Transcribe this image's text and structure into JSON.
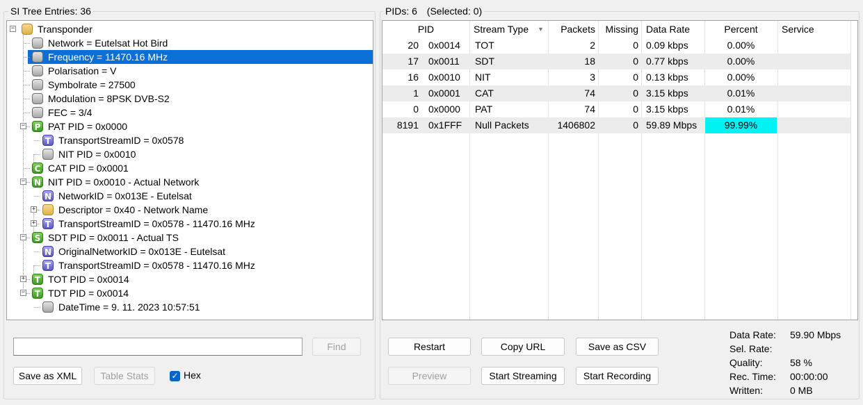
{
  "si_tree": {
    "title": "SI Tree Entries: 36",
    "nodes": [
      {
        "label": "Transponder",
        "icon": "folder-icon",
        "badge": ""
      },
      {
        "label": "Network = Eutelsat Hot Bird",
        "icon": "gray-node-icon",
        "badge": ""
      },
      {
        "label": "Frequency = 11470.16 MHz",
        "icon": "gray-node-icon",
        "badge": ""
      },
      {
        "label": "Polarisation = V",
        "icon": "gray-node-icon",
        "badge": ""
      },
      {
        "label": "Symbolrate = 27500",
        "icon": "gray-node-icon",
        "badge": ""
      },
      {
        "label": "Modulation = 8PSK DVB-S2",
        "icon": "gray-node-icon",
        "badge": ""
      },
      {
        "label": "FEC = 3/4",
        "icon": "gray-node-icon",
        "badge": ""
      },
      {
        "label": "PAT PID = 0x0000",
        "icon": "pat-icon",
        "badge": "P"
      },
      {
        "label": "TransportStreamID = 0x0578",
        "icon": "transport-stream-icon",
        "badge": "T"
      },
      {
        "label": "NIT PID = 0x0010",
        "icon": "gray-node-icon",
        "badge": ""
      },
      {
        "label": "CAT PID = 0x0001",
        "icon": "cat-icon",
        "badge": "C"
      },
      {
        "label": "NIT PID = 0x0010 - Actual Network",
        "icon": "nit-icon",
        "badge": "N"
      },
      {
        "label": "NetworkID = 0x013E - Eutelsat",
        "icon": "network-id-icon",
        "badge": "N"
      },
      {
        "label": "Descriptor = 0x40 - Network Name",
        "icon": "folder-icon",
        "badge": ""
      },
      {
        "label": "TransportStreamID = 0x0578 - 11470.16 MHz",
        "icon": "transport-stream-icon",
        "badge": "T"
      },
      {
        "label": "SDT PID = 0x0011 - Actual TS",
        "icon": "sdt-icon",
        "badge": "S"
      },
      {
        "label": "OriginalNetworkID = 0x013E - Eutelsat",
        "icon": "network-id-icon",
        "badge": "N"
      },
      {
        "label": "TransportStreamID = 0x0578 - 11470.16 MHz",
        "icon": "transport-stream-icon",
        "badge": "T"
      },
      {
        "label": "TOT PID = 0x0014",
        "icon": "tot-icon",
        "badge": "T"
      },
      {
        "label": "TDT PID = 0x0014",
        "icon": "tdt-icon",
        "badge": "T"
      },
      {
        "label": "DateTime = 9. 11. 2023 10:57:51",
        "icon": "gray-node-icon",
        "badge": ""
      }
    ],
    "search_value": "",
    "find_label": "Find",
    "save_xml_label": "Save as XML",
    "table_stats_label": "Table Stats",
    "hex_label": "Hex",
    "hex_checked": true
  },
  "pids": {
    "title": "PIDs: 6",
    "selected": "(Selected: 0)",
    "columns": [
      "PID",
      "Stream Type",
      "Packets",
      "Missing",
      "Data Rate",
      "Percent",
      "Service"
    ],
    "rows": [
      {
        "pid_dec": "20",
        "pid_hex": "0x0014",
        "stream_type": "TOT",
        "packets": "2",
        "missing": "0",
        "data_rate": "0.09 kbps",
        "percent": "0.00%",
        "percent_value": 0.0,
        "service": ""
      },
      {
        "pid_dec": "17",
        "pid_hex": "0x0011",
        "stream_type": "SDT",
        "packets": "18",
        "missing": "0",
        "data_rate": "0.77 kbps",
        "percent": "0.00%",
        "percent_value": 0.0,
        "service": ""
      },
      {
        "pid_dec": "16",
        "pid_hex": "0x0010",
        "stream_type": "NIT",
        "packets": "3",
        "missing": "0",
        "data_rate": "0.13 kbps",
        "percent": "0.00%",
        "percent_value": 0.0,
        "service": ""
      },
      {
        "pid_dec": "1",
        "pid_hex": "0x0001",
        "stream_type": "CAT",
        "packets": "74",
        "missing": "0",
        "data_rate": "3.15 kbps",
        "percent": "0.01%",
        "percent_value": 0.01,
        "service": ""
      },
      {
        "pid_dec": "0",
        "pid_hex": "0x0000",
        "stream_type": "PAT",
        "packets": "74",
        "missing": "0",
        "data_rate": "3.15 kbps",
        "percent": "0.01%",
        "percent_value": 0.01,
        "service": ""
      },
      {
        "pid_dec": "8191",
        "pid_hex": "0x1FFF",
        "stream_type": "Null Packets",
        "packets": "1406802",
        "missing": "0",
        "data_rate": "59.89 Mbps",
        "percent": "99.99%",
        "percent_value": 99.99,
        "service": ""
      }
    ],
    "percent_bar_color": "#00f2f2"
  },
  "buttons": {
    "restart": "Restart",
    "copy_url": "Copy URL",
    "save_csv": "Save as CSV",
    "preview": "Preview",
    "start_streaming": "Start Streaming",
    "start_recording": "Start Recording"
  },
  "stats": {
    "data_rate_label": "Data Rate:",
    "data_rate_value": "59.90 Mbps",
    "sel_rate_label": "Sel. Rate:",
    "sel_rate_value": "",
    "quality_label": "Quality:",
    "quality_value": "58 %",
    "rec_time_label": "Rec. Time:",
    "rec_time_value": "00:00:00",
    "written_label": "Written:",
    "written_value": "0 MB"
  },
  "colors": {
    "selection": "#0a6fd6",
    "accent": "#0a64c8"
  }
}
